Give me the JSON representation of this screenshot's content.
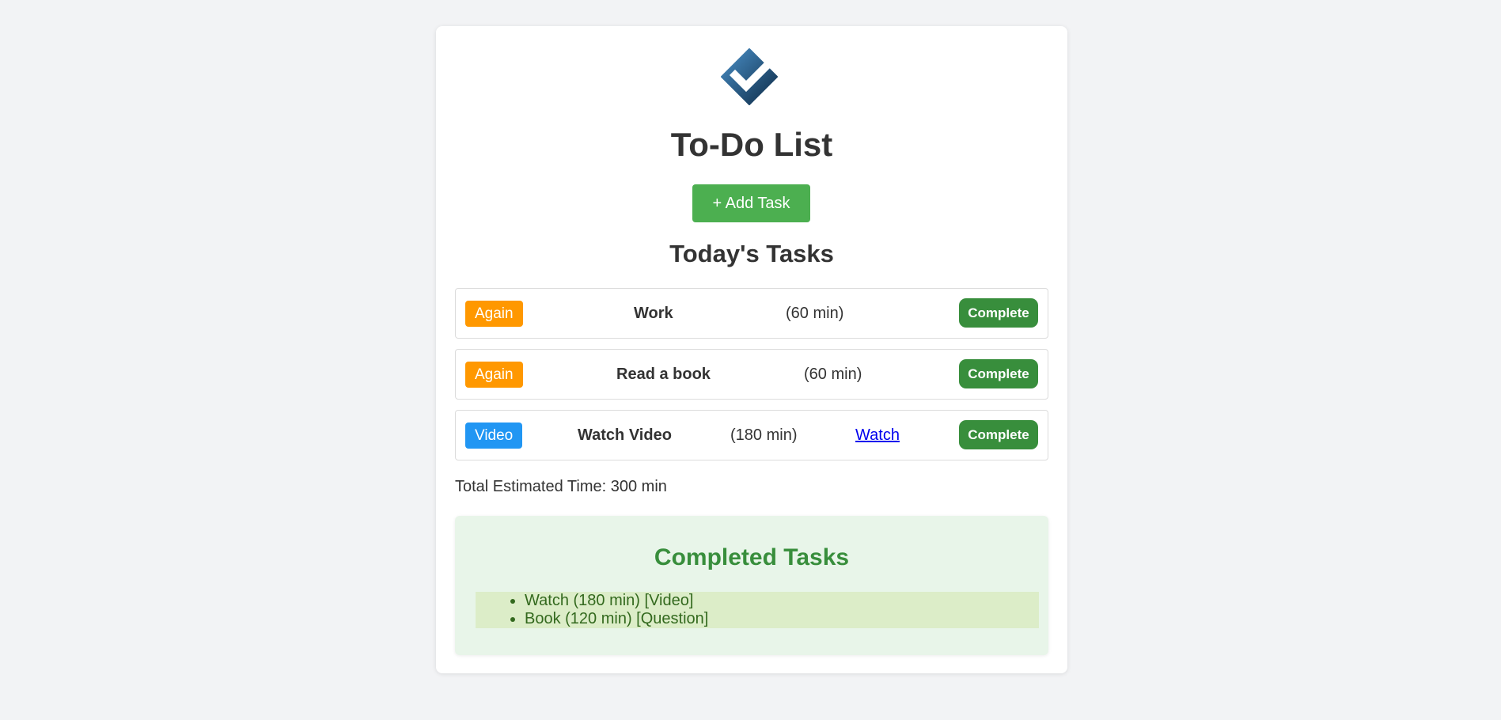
{
  "app": {
    "logo_icon": "checkmark-diamond-logo",
    "title": "To-Do List",
    "add_button_label": "+ Add Task",
    "section_title": "Today's Tasks"
  },
  "tasks": [
    {
      "badge": "Again",
      "badge_color": "#ff9800",
      "name": "Work",
      "duration": "(60 min)",
      "action": "Complete"
    },
    {
      "badge": "Again",
      "badge_color": "#ff9800",
      "name": "Read a book",
      "duration": "(60 min)",
      "action": "Complete"
    },
    {
      "badge": "Video",
      "badge_color": "#2196f3",
      "name": "Watch Video",
      "duration": "(180 min)",
      "link": "Watch",
      "action": "Complete"
    }
  ],
  "total_time": "Total Estimated Time: 300 min",
  "completed": {
    "title": "Completed Tasks",
    "items": [
      "Watch (180 min) [Video]",
      "Book (120 min) [Question]"
    ]
  },
  "colors": {
    "primary_green": "#4caf50",
    "complete_green": "#388e3c",
    "completed_bg": "#e8f5e9"
  }
}
